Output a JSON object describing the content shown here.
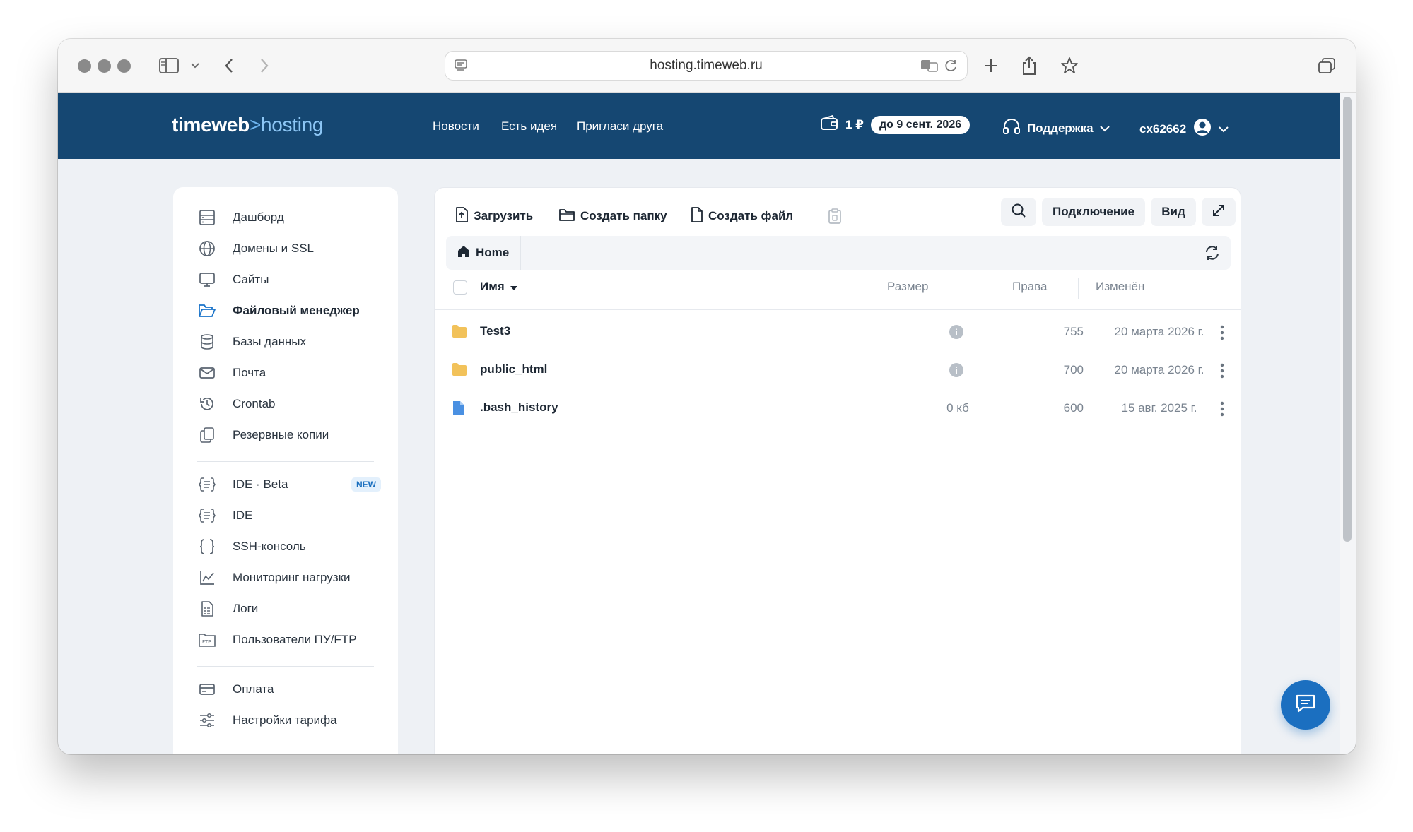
{
  "browser": {
    "url": "hosting.timeweb.ru"
  },
  "header": {
    "logo_main": "timeweb",
    "logo_sep": ">",
    "logo_sub": "hosting",
    "nav": [
      "Новости",
      "Есть идея",
      "Пригласи друга"
    ],
    "balance": "1 ₽",
    "paid_until": "до 9 сент. 2026",
    "support": "Поддержка",
    "account": "cx62662"
  },
  "sidebar": {
    "group1": [
      {
        "label": "Дашборд",
        "icon": "dashboard-icon"
      },
      {
        "label": "Домены и SSL",
        "icon": "globe-icon"
      },
      {
        "label": "Сайты",
        "icon": "monitor-icon"
      },
      {
        "label": "Файловый менеджер",
        "icon": "folder-open-icon",
        "active": true
      },
      {
        "label": "Базы данных",
        "icon": "database-icon"
      },
      {
        "label": "Почта",
        "icon": "mail-icon"
      },
      {
        "label": "Crontab",
        "icon": "history-icon"
      },
      {
        "label": "Резервные копии",
        "icon": "copies-icon"
      }
    ],
    "group2": [
      {
        "label": "IDE · Beta",
        "icon": "ide-icon",
        "badge": "NEW"
      },
      {
        "label": "IDE",
        "icon": "ide-icon"
      },
      {
        "label": "SSH-консоль",
        "icon": "braces-icon"
      },
      {
        "label": "Мониторинг нагрузки",
        "icon": "chart-icon"
      },
      {
        "label": "Логи",
        "icon": "log-icon"
      },
      {
        "label": "Пользователи ПУ/FTP",
        "icon": "ftp-icon"
      }
    ],
    "group3": [
      {
        "label": "Оплата",
        "icon": "card-icon"
      },
      {
        "label": "Настройки тарифа",
        "icon": "sliders-icon"
      }
    ]
  },
  "toolbar": {
    "upload": "Загрузить",
    "new_folder": "Создать папку",
    "new_file": "Создать файл",
    "connect": "Подключение",
    "view": "Вид"
  },
  "breadcrumb": {
    "home": "Home"
  },
  "table": {
    "columns": {
      "name": "Имя",
      "size": "Размер",
      "perms": "Права",
      "modified": "Изменён"
    },
    "rows": [
      {
        "name": "Test3",
        "type": "folder",
        "size": "",
        "perms": "755",
        "modified": "20 марта 2026 г."
      },
      {
        "name": "public_html",
        "type": "folder",
        "size": "",
        "perms": "700",
        "modified": "20 марта 2026 г."
      },
      {
        "name": ".bash_history",
        "type": "file",
        "size": "0 кб",
        "perms": "600",
        "modified": "15 авг. 2025 г."
      }
    ]
  },
  "colors": {
    "header_bg": "#154772",
    "accent": "#1a73c9",
    "folder": "#f2c25a",
    "file": "#4a90e2"
  }
}
